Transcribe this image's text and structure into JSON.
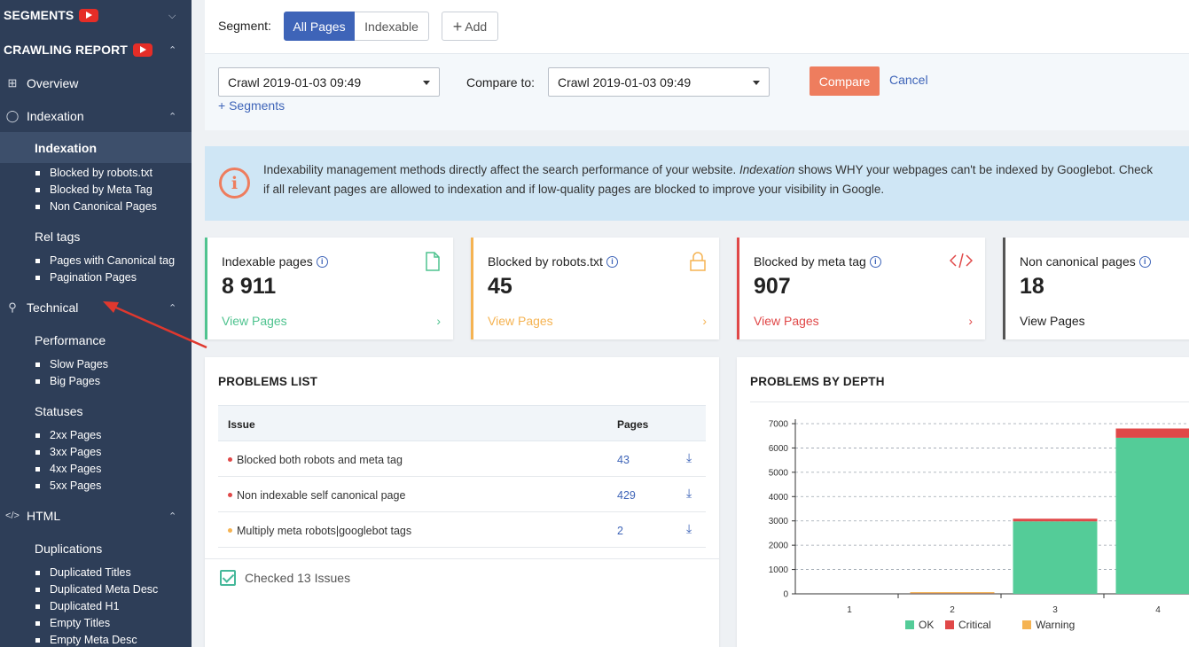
{
  "sidebar": {
    "segments": "SEGMENTS",
    "crawling_report": "CRAWLING REPORT",
    "overview": "Overview",
    "indexation": "Indexation",
    "indexation_sub": "Indexation",
    "indexation_leaves": [
      "Blocked by robots.txt",
      "Blocked by Meta Tag",
      "Non Canonical Pages"
    ],
    "rel_tags": "Rel tags",
    "rel_leaves": [
      "Pages with Canonical tag",
      "Pagination Pages"
    ],
    "technical": "Technical",
    "performance": "Performance",
    "performance_leaves": [
      "Slow Pages",
      "Big Pages"
    ],
    "statuses": "Statuses",
    "status_leaves": [
      "2xx Pages",
      "3xx Pages",
      "4xx Pages",
      "5xx Pages"
    ],
    "html": "HTML",
    "duplications": "Duplications",
    "duplication_leaves": [
      "Duplicated Titles",
      "Duplicated Meta Desc",
      "Duplicated H1",
      "Empty Titles",
      "Empty Meta Desc"
    ]
  },
  "topbar": {
    "segment_label": "Segment:",
    "all_pages": "All Pages",
    "indexable": "Indexable",
    "add": "Add"
  },
  "filters": {
    "crawl_value": "Crawl 2019-01-03 09:49",
    "compare_label": "Compare to:",
    "compare_value": "Crawl 2019-01-03 09:49",
    "compare_button": "Compare",
    "cancel": "Cancel",
    "segments_link": "+ Segments"
  },
  "info": {
    "line1_a": "Indexability management methods directly affect the search performance of your website.",
    "line1_em": "Indexation",
    "line1_b": "shows WHY your webpages can't be indexed by Googlebot. Check",
    "line2": "if all relevant pages are allowed to indexation and if low-quality pages are blocked to improve your visibility in Google."
  },
  "cards": [
    {
      "title": "Indexable pages",
      "value": "8 911",
      "link": "View Pages",
      "color": "#4fc38f"
    },
    {
      "title": "Blocked by robots.txt",
      "value": "45",
      "link": "View Pages",
      "color": "#f5b352"
    },
    {
      "title": "Blocked by meta tag",
      "value": "907",
      "link": "View Pages",
      "color": "#e04848"
    },
    {
      "title": "Non canonical pages",
      "value": "18",
      "link": "View Pages",
      "color": "#555555"
    }
  ],
  "problems": {
    "title": "PROBLEMS LIST",
    "col_issue": "Issue",
    "col_pages": "Pages",
    "rows": [
      {
        "issue": "Blocked both robots and meta tag",
        "pages": "43",
        "color": "#e04848"
      },
      {
        "issue": "Non indexable self canonical page",
        "pages": "429",
        "color": "#e04848"
      },
      {
        "issue": "Multiply meta robots|googlebot tags",
        "pages": "2",
        "color": "#f5b352"
      }
    ],
    "checked": "Checked 13 Issues"
  },
  "chart_data": {
    "type": "bar",
    "title": "PROBLEMS BY DEPTH",
    "categories": [
      "1",
      "2",
      "3",
      "4"
    ],
    "series": [
      {
        "name": "OK",
        "color": "#54cc98",
        "values": [
          0,
          40,
          2980,
          6420
        ]
      },
      {
        "name": "Critical",
        "color": "#e04848",
        "values": [
          0,
          10,
          110,
          380
        ]
      },
      {
        "name": "Warning",
        "color": "#f5b352",
        "values": [
          0,
          20,
          0,
          0
        ]
      }
    ],
    "ylim": [
      0,
      7000
    ],
    "yticks": [
      "0",
      "1000",
      "2000",
      "3000",
      "4000",
      "5000",
      "6000",
      "7000"
    ],
    "stacked": true,
    "grid": true,
    "legend": "bottom"
  }
}
